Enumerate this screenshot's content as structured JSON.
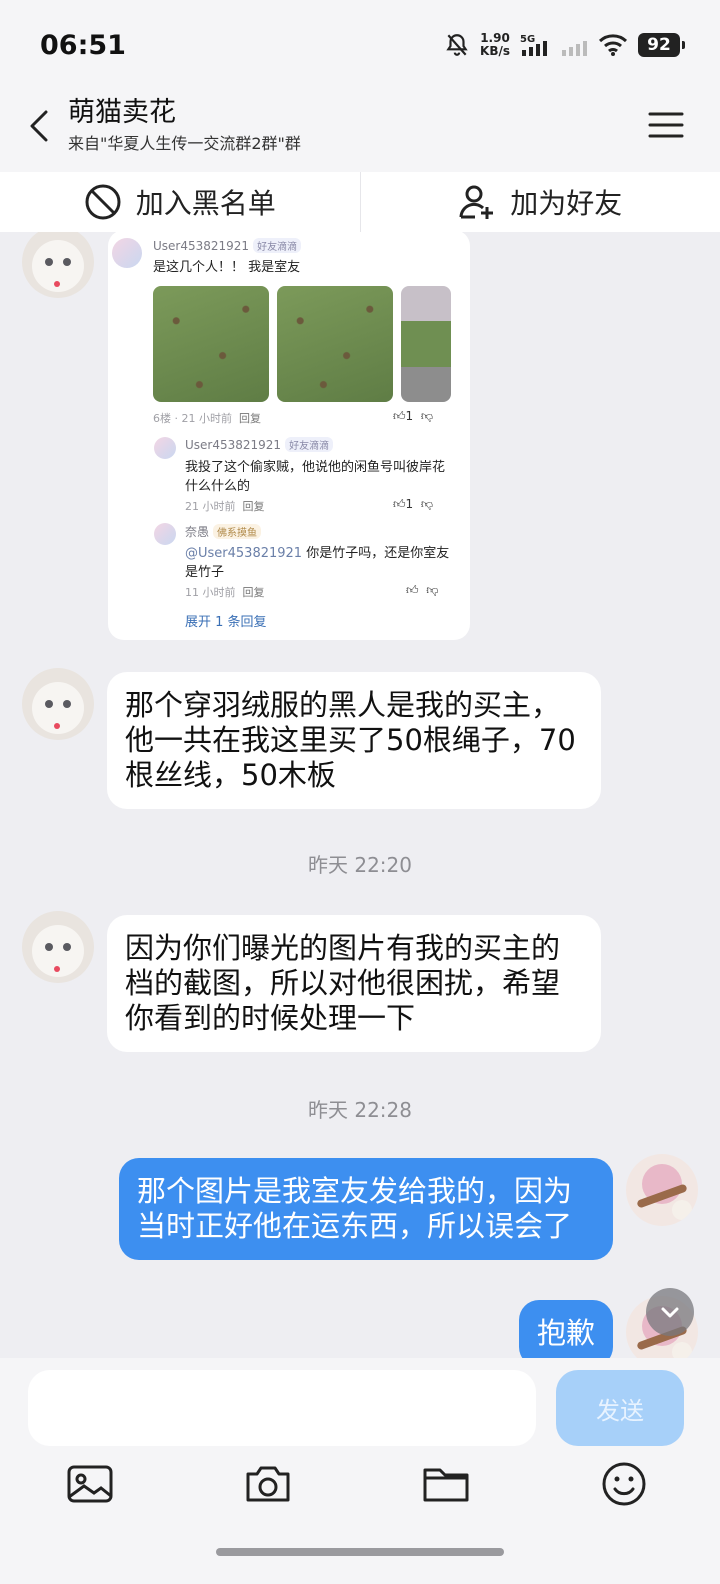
{
  "status": {
    "time": "06:51",
    "net_speed_value": "1.90",
    "net_speed_unit": "KB/s",
    "network": "5G",
    "battery": "92"
  },
  "header": {
    "title": "萌猫卖花",
    "subtitle": "来自\"华夏人生传一交流群2群\"群"
  },
  "actions": {
    "blacklist_label": "加入黑名单",
    "add_friend_label": "加为好友"
  },
  "screenshot": {
    "user1": "User453821921",
    "tag1": "好友滴滴",
    "comment1": "是这几个人！！ 我是室友",
    "meta1": "6楼 · 21 小时前",
    "reply_word": "回复",
    "likes1": "1",
    "user2": "User453821921",
    "tag2": "好友滴滴",
    "comment2": "我投了这个偷家贼，他说他的闲鱼号叫彼岸花什么什么的",
    "meta2": "21 小时前",
    "likes2": "1",
    "user3": "奈愚",
    "tag3": "佛系摸鱼",
    "mention": "@User453821921",
    "comment3": " 你是竹子吗，还是你室友是竹子",
    "meta3": "11 小时前",
    "expand": "展开 1 条回复"
  },
  "messages": [
    {
      "side": "them",
      "text": "那个穿羽绒服的黑人是我的买主，他一共在我这里买了50根绳子，70根丝线，50木板"
    },
    {
      "side": "them",
      "text": "因为你们曝光的图片有我的买主的档的截图，所以对他很困扰，希望你看到的时候处理一下"
    },
    {
      "side": "me",
      "text": "那个图片是我室友发给我的，因为当时正好他在运东西，所以误会了"
    },
    {
      "side": "me",
      "text": "抱歉"
    }
  ],
  "time_separators": [
    "昨天 22:20",
    "昨天 22:28"
  ],
  "input": {
    "placeholder": "",
    "send_label": "发送"
  },
  "colors": {
    "my_bubble": "#3d8ff0",
    "send_disabled": "#a7d0f9",
    "background": "#eeeef2"
  },
  "icons": [
    "back-icon",
    "menu-icon",
    "block-icon",
    "add-friend-icon",
    "image-icon",
    "camera-icon",
    "folder-icon",
    "emoji-icon",
    "chevron-down-icon"
  ]
}
